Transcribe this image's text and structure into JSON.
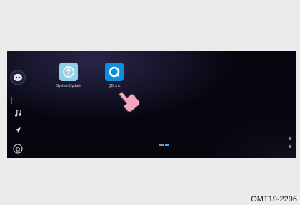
{
  "apps": [
    {
      "name": "System Update",
      "icon": "upload-icon",
      "color": "#8fd1ea"
    },
    {
      "name": "QDLink",
      "icon": "q-icon",
      "color": "#0b8fe0"
    }
  ],
  "sidebar": {
    "items": [
      {
        "icon": "assistant-avatar-icon"
      },
      {
        "icon": "music-note-icon"
      },
      {
        "icon": "navigation-arrow-icon"
      },
      {
        "icon": "home-icon"
      }
    ]
  },
  "pointer": {
    "icon": "pointing-hand-icon",
    "color": "#f4a7c0"
  },
  "figure_code": "OMT19-2296"
}
